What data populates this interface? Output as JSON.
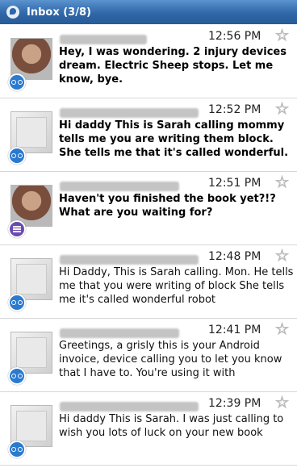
{
  "titlebar": {
    "title": "Inbox (3/8)",
    "icon": "voicemail-app-icon"
  },
  "messages": [
    {
      "time": "12:56 PM",
      "text": "Hey, I was wondering. 2 injury devices dream. Electric Sheep stops. Let me know, bye.",
      "unread": true,
      "avatar": "photo",
      "badge": "voicemail-icon"
    },
    {
      "time": "12:52 PM",
      "text": "Hi daddy This is Sarah calling mommy tells me you are writing them block. She tells me that it's called wonderful.",
      "unread": true,
      "avatar": "blank",
      "badge": "voicemail-icon"
    },
    {
      "time": "12:51 PM",
      "text": "Haven't you finished the book yet?!? What are you waiting for?",
      "unread": true,
      "avatar": "photo",
      "badge": "sms-icon"
    },
    {
      "time": "12:48 PM",
      "text": "Hi Daddy, This is Sarah calling. Mon. He tells me that you were writing of block She tells me it's called wonderful robot",
      "unread": false,
      "avatar": "blank",
      "badge": "voicemail-icon"
    },
    {
      "time": "12:41 PM",
      "text": "Greetings, a grisly this is your Android invoice, device calling you to let you know that I have to. You're using it with",
      "unread": false,
      "avatar": "blank",
      "badge": "voicemail-icon"
    },
    {
      "time": "12:39 PM",
      "text": "Hi daddy This is Sarah. I was just calling to wish you lots of luck on your new book",
      "unread": false,
      "avatar": "blank",
      "badge": "voicemail-icon"
    }
  ],
  "colors": {
    "titlebar": "#2f67a8",
    "voicemail_badge": "#2a7ad0",
    "sms_badge": "#6a4bb0"
  }
}
